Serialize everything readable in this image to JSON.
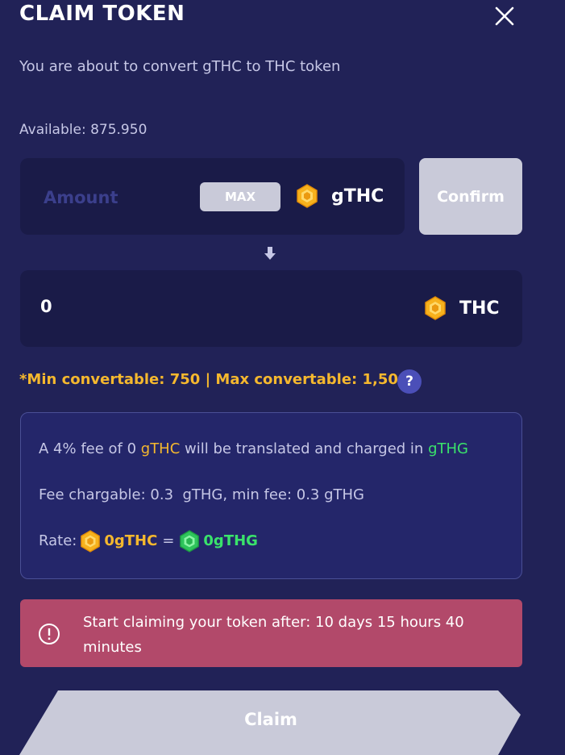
{
  "modal": {
    "title": "CLAIM TOKEN",
    "subtitle": "You are about to convert gTHC to THC token",
    "available": "Available: 875.950"
  },
  "convert": {
    "amount_placeholder": "Amount",
    "max_label": "MAX",
    "from_token": "gTHC",
    "confirm_label": "Confirm",
    "to_value": "0",
    "to_token": "THC"
  },
  "limits": {
    "text": "*Min convertable: 750 | Max convertable: 1,500",
    "help_label": "?"
  },
  "fee": {
    "line1_prefix": "A 4% fee of 0 ",
    "line1_token": "gTHC",
    "line1_mid": " will be translated and charged in ",
    "line1_charge_token": "gTHG",
    "line2": "Fee chargable: 0.3  gTHG, min fee: 0.3 gTHG",
    "rate_label": "Rate:",
    "rate_from": "0gTHC",
    "rate_eq": "=",
    "rate_to": "0gTHG"
  },
  "alert": {
    "text": "Start claiming your token after: 10 days 15 hours 40 minutes"
  },
  "actions": {
    "claim_label": "Claim"
  },
  "colors": {
    "background": "#212257",
    "gold": "#f5b82e",
    "green": "#3ae36b",
    "alert": "#b2496a",
    "disabled_button": "#c9cad9"
  },
  "icons": {
    "close": "close-icon",
    "gthc": "gold-hexagon-token-icon",
    "thc": "gold-hexagon-token-icon",
    "gthg": "green-hexagon-token-icon",
    "arrow": "arrow-down-icon",
    "alert": "exclamation-circle-icon"
  }
}
